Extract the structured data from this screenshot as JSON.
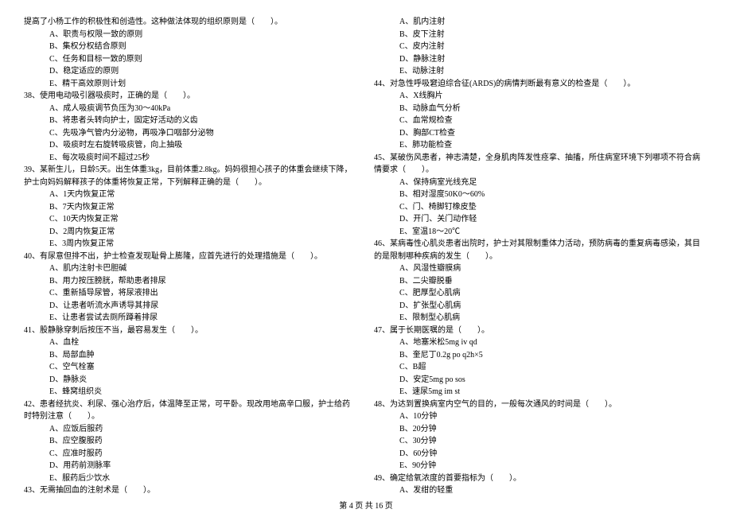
{
  "left_column": [
    {
      "text": "提高了小杨工作的积极性和创造性。这种做法体现的组织原则是（　　）。",
      "indent": 0
    },
    {
      "text": "A、职责与权限一致的原则",
      "indent": 1
    },
    {
      "text": "B、集权分权结合原则",
      "indent": 1
    },
    {
      "text": "C、任务和目标一致的原则",
      "indent": 1
    },
    {
      "text": "D、稳定适应的原则",
      "indent": 1
    },
    {
      "text": "E、精干高效原则计划",
      "indent": 1
    },
    {
      "text": "38、使用电动吸引器吸痰时，正确的是（　　）。",
      "indent": 0
    },
    {
      "text": "A、成人吸痰调节负压为30～40kPa",
      "indent": 1
    },
    {
      "text": "B、将患者头转向护士，固定好活动的义齿",
      "indent": 1
    },
    {
      "text": "C、先吸净气管内分泌物，再吸净口咽部分泌物",
      "indent": 1
    },
    {
      "text": "D、吸痰时左右旋转吸痰管，向上抽吸",
      "indent": 1
    },
    {
      "text": "E、每次吸痰时间不超过25秒",
      "indent": 1
    },
    {
      "text": "39、某新生儿，日龄5天。出生体重3kg，目前体重2.8kg。妈妈很担心孩子的体重会继续下降，",
      "indent": 0
    },
    {
      "text": "护士向妈妈解释孩子的体重将恢复正常，下列解释正确的是（　　）。",
      "indent": 0
    },
    {
      "text": "A、1天内恢复正常",
      "indent": 1
    },
    {
      "text": "B、7天内恢复正常",
      "indent": 1
    },
    {
      "text": "C、10天内恢复正常",
      "indent": 1
    },
    {
      "text": "D、2周内恢复正常",
      "indent": 1
    },
    {
      "text": "E、3周内恢复正常",
      "indent": 1
    },
    {
      "text": "40、有尿意但排不出，护士检查发现耻骨上膨隆，应首先进行的处理措施是（　　）。",
      "indent": 0
    },
    {
      "text": "A、肌内注射卡巴胆碱",
      "indent": 1
    },
    {
      "text": "B、用力按压膀胱，帮助患者排尿",
      "indent": 1
    },
    {
      "text": "C、重新插导尿管，将尿液排出",
      "indent": 1
    },
    {
      "text": "D、让患者听流水声诱导其排尿",
      "indent": 1
    },
    {
      "text": "E、让患者尝试去厕所蹲着排尿",
      "indent": 1
    },
    {
      "text": "41、股静脉穿刺后按压不当，最容易发生（　　）。",
      "indent": 0
    },
    {
      "text": "A、血栓",
      "indent": 1
    },
    {
      "text": "B、局部血肿",
      "indent": 1
    },
    {
      "text": "C、空气栓塞",
      "indent": 1
    },
    {
      "text": "D、静脉炎",
      "indent": 1
    },
    {
      "text": "E、蜂窝组织炎",
      "indent": 1
    },
    {
      "text": "42、患者经抗炎、利尿、强心治疗后，体温降至正常，可平卧。现改用地高辛口服，护士给药",
      "indent": 0
    },
    {
      "text": "时特别注意（　　）。",
      "indent": 0
    },
    {
      "text": "A、应饭后服药",
      "indent": 1
    },
    {
      "text": "B、应空腹服药",
      "indent": 1
    },
    {
      "text": "C、应准时服药",
      "indent": 1
    },
    {
      "text": "D、用药前测脉率",
      "indent": 1
    },
    {
      "text": "E、服药后少饮水",
      "indent": 1
    },
    {
      "text": "43、无需抽回血的注射术是（　　）。",
      "indent": 0
    }
  ],
  "right_column": [
    {
      "text": "A、肌内注射",
      "indent": 1
    },
    {
      "text": "B、皮下注射",
      "indent": 1
    },
    {
      "text": "C、皮内注射",
      "indent": 1
    },
    {
      "text": "D、静脉注射",
      "indent": 1
    },
    {
      "text": "E、动脉注射",
      "indent": 1
    },
    {
      "text": "44、对急性呼吸窘迫综合征(ARDS)的病情判断最有意义的检查是（　　）。",
      "indent": 0
    },
    {
      "text": "A、X线胸片",
      "indent": 1
    },
    {
      "text": "B、动脉血气分析",
      "indent": 1
    },
    {
      "text": "C、血常规检查",
      "indent": 1
    },
    {
      "text": "D、胸部CT检查",
      "indent": 1
    },
    {
      "text": "E、肺功能检查",
      "indent": 1
    },
    {
      "text": "45、某破伤风患者，神志清楚，全身肌肉阵发性痉挛、抽搐，所住病室环境下列哪项不符合病",
      "indent": 0
    },
    {
      "text": "情要求（　　）。",
      "indent": 0
    },
    {
      "text": "A、保持病室光线充足",
      "indent": 1
    },
    {
      "text": "B、相对湿度50K0～60%",
      "indent": 1
    },
    {
      "text": "C、门、椅脚钉橡皮垫",
      "indent": 1
    },
    {
      "text": "D、开门、关门动作轻",
      "indent": 1
    },
    {
      "text": "E、室温18～20℃",
      "indent": 1
    },
    {
      "text": "46、某病毒性心肌炎患者出院时，护士对其限制重体力活动，预防病毒的重复病毒感染，其目",
      "indent": 0
    },
    {
      "text": "的是限制哪种疾病的发生（　　）。",
      "indent": 0
    },
    {
      "text": "A、风湿性瓣膜病",
      "indent": 1
    },
    {
      "text": "B、二尖瓣脱垂",
      "indent": 1
    },
    {
      "text": "C、肥厚型心肌病",
      "indent": 1
    },
    {
      "text": "D、扩张型心肌病",
      "indent": 1
    },
    {
      "text": "E、限制型心肌病",
      "indent": 1
    },
    {
      "text": "47、属于长期医嘱的是（　　）。",
      "indent": 0
    },
    {
      "text": "A、地塞米松5mg iv qd",
      "indent": 1
    },
    {
      "text": "B、奎尼丁0.2g po q2h×5",
      "indent": 1
    },
    {
      "text": "C、B超",
      "indent": 1
    },
    {
      "text": "D、安定5mg po sos",
      "indent": 1
    },
    {
      "text": "E、速尿5mg im st",
      "indent": 1
    },
    {
      "text": "48、为达到置换病室内空气的目的，一般每次通风的时间是（　　）。",
      "indent": 0
    },
    {
      "text": "A、10分钟",
      "indent": 1
    },
    {
      "text": "B、20分钟",
      "indent": 1
    },
    {
      "text": "C、30分钟",
      "indent": 1
    },
    {
      "text": "D、60分钟",
      "indent": 1
    },
    {
      "text": "E、90分钟",
      "indent": 1
    },
    {
      "text": "49、确定给氧浓度的首要指标为（　　）。",
      "indent": 0
    },
    {
      "text": "A、发绀的轻重",
      "indent": 1
    }
  ],
  "footer": "第 4 页 共 16 页"
}
